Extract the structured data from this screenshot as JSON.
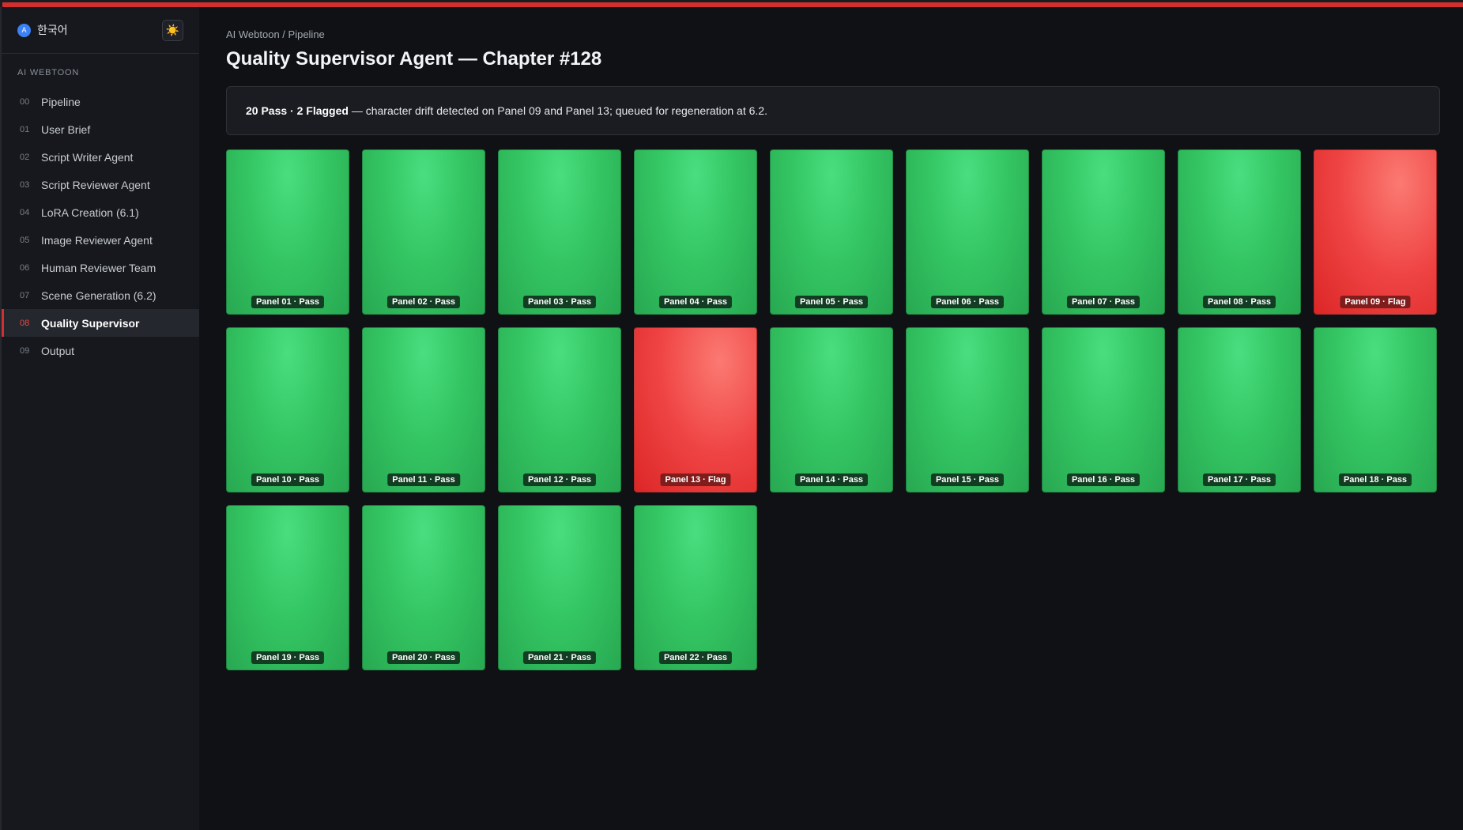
{
  "sidebar": {
    "language": "한국어",
    "language_icon": "A",
    "theme_icon": "☀️",
    "section_label": "AI WEBTOON",
    "items": [
      {
        "num": "00",
        "label": "Pipeline"
      },
      {
        "num": "01",
        "label": "User Brief"
      },
      {
        "num": "02",
        "label": "Script Writer Agent"
      },
      {
        "num": "03",
        "label": "Script Reviewer Agent"
      },
      {
        "num": "04",
        "label": "LoRA Creation (6.1)"
      },
      {
        "num": "05",
        "label": "Image Reviewer Agent"
      },
      {
        "num": "06",
        "label": "Human Reviewer Team"
      },
      {
        "num": "07",
        "label": "Scene Generation (6.2)"
      },
      {
        "num": "08",
        "label": "Quality Supervisor",
        "active": true
      },
      {
        "num": "09",
        "label": "Output"
      }
    ]
  },
  "main": {
    "breadcrumb": "AI Webtoon / Pipeline",
    "title": "Quality Supervisor Agent — Chapter #128",
    "summary_bold": "20 Pass · 2 Flagged",
    "summary_text": " — character drift detected on Panel 09 and Panel 13; queued for regeneration at 6.2.",
    "panels": [
      {
        "label": "Panel 01 · Pass",
        "status": "pass"
      },
      {
        "label": "Panel 02 · Pass",
        "status": "pass"
      },
      {
        "label": "Panel 03 · Pass",
        "status": "pass"
      },
      {
        "label": "Panel 04 · Pass",
        "status": "pass"
      },
      {
        "label": "Panel 05 · Pass",
        "status": "pass"
      },
      {
        "label": "Panel 06 · Pass",
        "status": "pass"
      },
      {
        "label": "Panel 07 · Pass",
        "status": "pass"
      },
      {
        "label": "Panel 08 · Pass",
        "status": "pass"
      },
      {
        "label": "Panel 09 · Flag",
        "status": "flag"
      },
      {
        "label": "Panel 10 · Pass",
        "status": "pass"
      },
      {
        "label": "Panel 11 · Pass",
        "status": "pass"
      },
      {
        "label": "Panel 12 · Pass",
        "status": "pass"
      },
      {
        "label": "Panel 13 · Flag",
        "status": "flag"
      },
      {
        "label": "Panel 14 · Pass",
        "status": "pass"
      },
      {
        "label": "Panel 15 · Pass",
        "status": "pass"
      },
      {
        "label": "Panel 16 · Pass",
        "status": "pass"
      },
      {
        "label": "Panel 17 · Pass",
        "status": "pass"
      },
      {
        "label": "Panel 18 · Pass",
        "status": "pass"
      },
      {
        "label": "Panel 19 · Pass",
        "status": "pass"
      },
      {
        "label": "Panel 20 · Pass",
        "status": "pass"
      },
      {
        "label": "Panel 21 · Pass",
        "status": "pass"
      },
      {
        "label": "Panel 22 · Pass",
        "status": "pass"
      }
    ]
  },
  "colors": {
    "accent": "#d32f2f",
    "pass": "#34c663",
    "flag": "#ef4444",
    "background": "#0f1115"
  }
}
